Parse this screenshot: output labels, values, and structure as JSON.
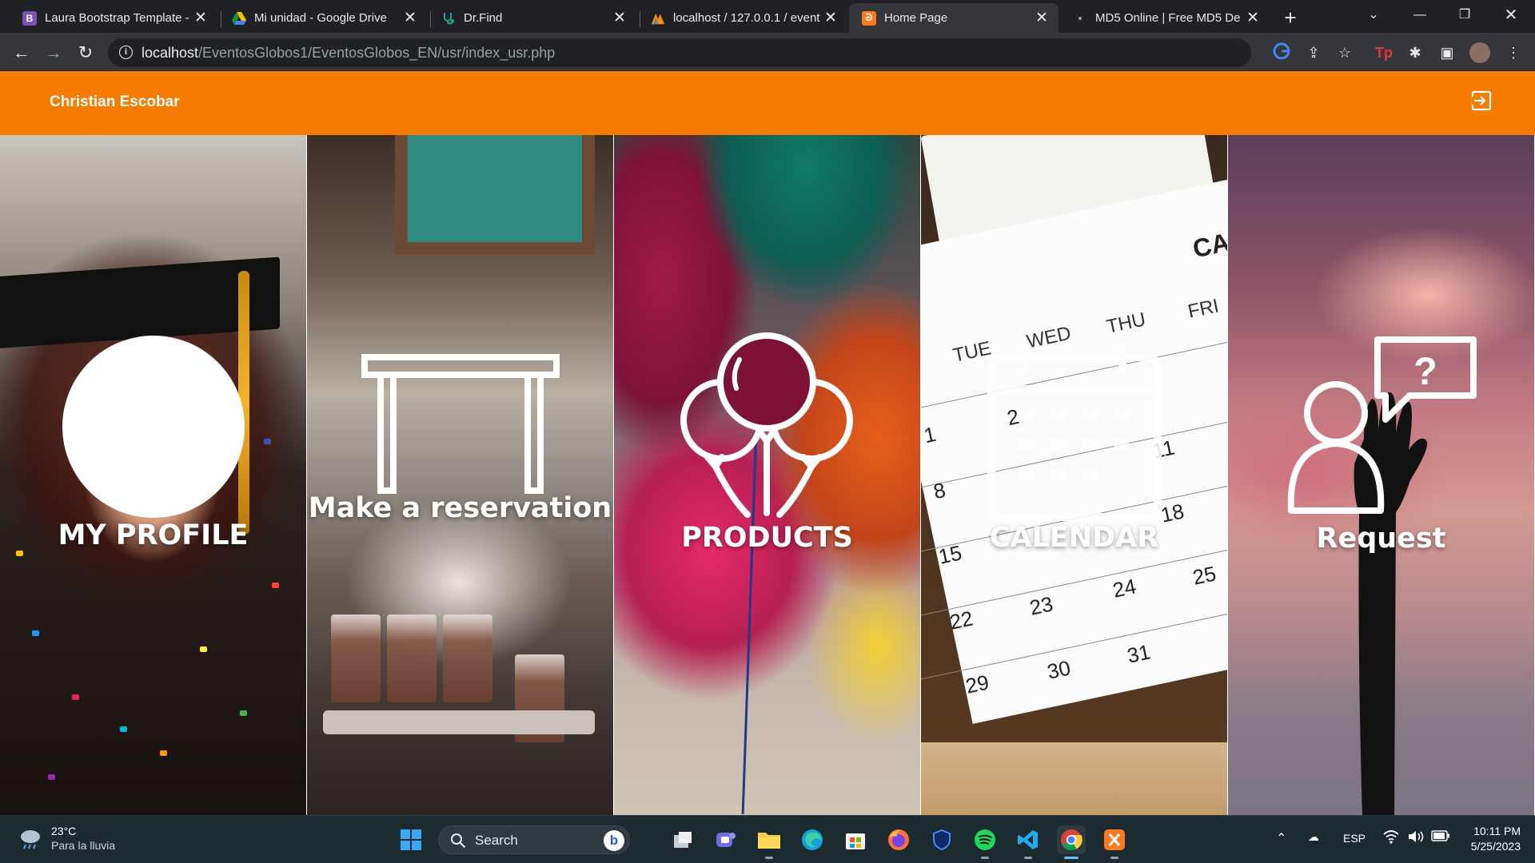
{
  "browser": {
    "tabs": [
      {
        "title": "Laura Bootstrap Template -",
        "favicon": "bootstrap-icon",
        "fav_color": "#7952b3",
        "fav_text": "B"
      },
      {
        "title": "Mi unidad - Google Drive",
        "favicon": "google-drive-icon",
        "fav_color": "#1e8e3e",
        "fav_text": ""
      },
      {
        "title": "Dr.Find",
        "favicon": "stethoscope-icon",
        "fav_color": "#26a69a",
        "fav_text": ""
      },
      {
        "title": "localhost / 127.0.0.1 / event",
        "favicon": "phpmyadmin-icon",
        "fav_color": "#f29111",
        "fav_text": ""
      },
      {
        "title": "Home Page",
        "favicon": "xampp-icon",
        "fav_color": "#fb7a24",
        "fav_text": "",
        "active": true
      },
      {
        "title": "MD5 Online | Free MD5 De",
        "favicon": "dot-icon",
        "fav_color": "#202124",
        "fav_text": ""
      }
    ],
    "url_host": "localhost",
    "url_path": "/EventosGlobos1/EventosGlobos_EN/usr/index_usr.php"
  },
  "navbar": {
    "brand": "Christian Escobar",
    "logout_icon": "logout-icon",
    "color": "#f57c00"
  },
  "panels": [
    {
      "label": "MY PROFILE",
      "icon": "profile-icon"
    },
    {
      "label": "Make a reservation",
      "icon": "table-icon"
    },
    {
      "label": "PRODUCTS",
      "icon": "balloons-icon"
    },
    {
      "label": "CALENDAR",
      "icon": "calendar-icon"
    },
    {
      "label": "Request",
      "icon": "request-icon"
    }
  ],
  "calendar_photo": {
    "header": "CA",
    "days": [
      "TUE",
      "WED",
      "THU",
      "FRI"
    ],
    "numbers": [
      "1",
      "2",
      "8",
      "11",
      "15",
      "18",
      "22",
      "23",
      "24",
      "25",
      "29",
      "30",
      "31"
    ]
  },
  "taskbar": {
    "weather_temp": "23°C",
    "weather_desc": "Para la lluvia",
    "search_placeholder": "Search",
    "language": "ESP",
    "time": "10:11 PM",
    "date": "5/25/2023"
  }
}
